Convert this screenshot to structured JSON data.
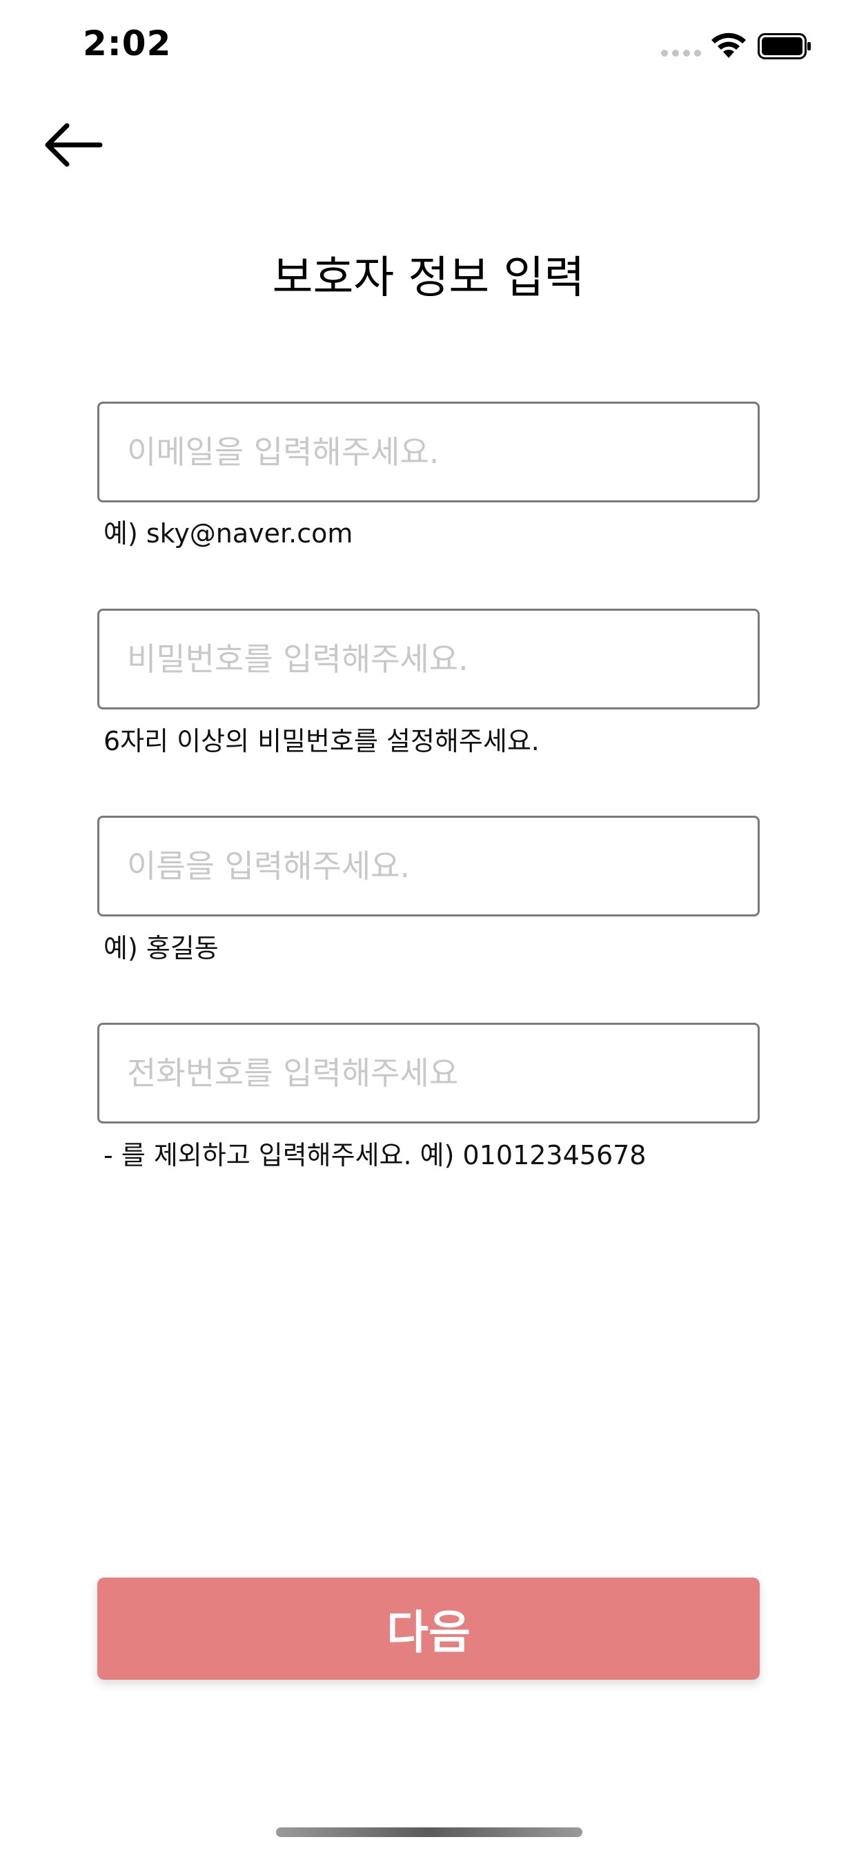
{
  "status_bar": {
    "time": "2:02"
  },
  "header": {
    "title": "보호자 정보 입력"
  },
  "form": {
    "email": {
      "placeholder": "이메일을 입력해주세요.",
      "value": "",
      "hint": "예) sky@naver.com"
    },
    "password": {
      "placeholder": "비밀번호를 입력해주세요.",
      "value": "",
      "hint": "6자리 이상의 비밀번호를 설정해주세요."
    },
    "name": {
      "placeholder": "이름을 입력해주세요.",
      "value": "",
      "hint": "예) 홍길동"
    },
    "phone": {
      "placeholder": "전화번호를 입력해주세요",
      "value": "",
      "hint": "- 를 제외하고 입력해주세요. 예) 01012345678"
    }
  },
  "footer": {
    "next_label": "다음"
  },
  "colors": {
    "primary_button": "#e58080",
    "field_border": "#7a7a7a",
    "placeholder": "#c8c8c8"
  },
  "icons": {
    "back": "arrow-left-icon",
    "wifi": "wifi-icon",
    "battery": "battery-icon",
    "signal": "cellular-signal-icon"
  }
}
